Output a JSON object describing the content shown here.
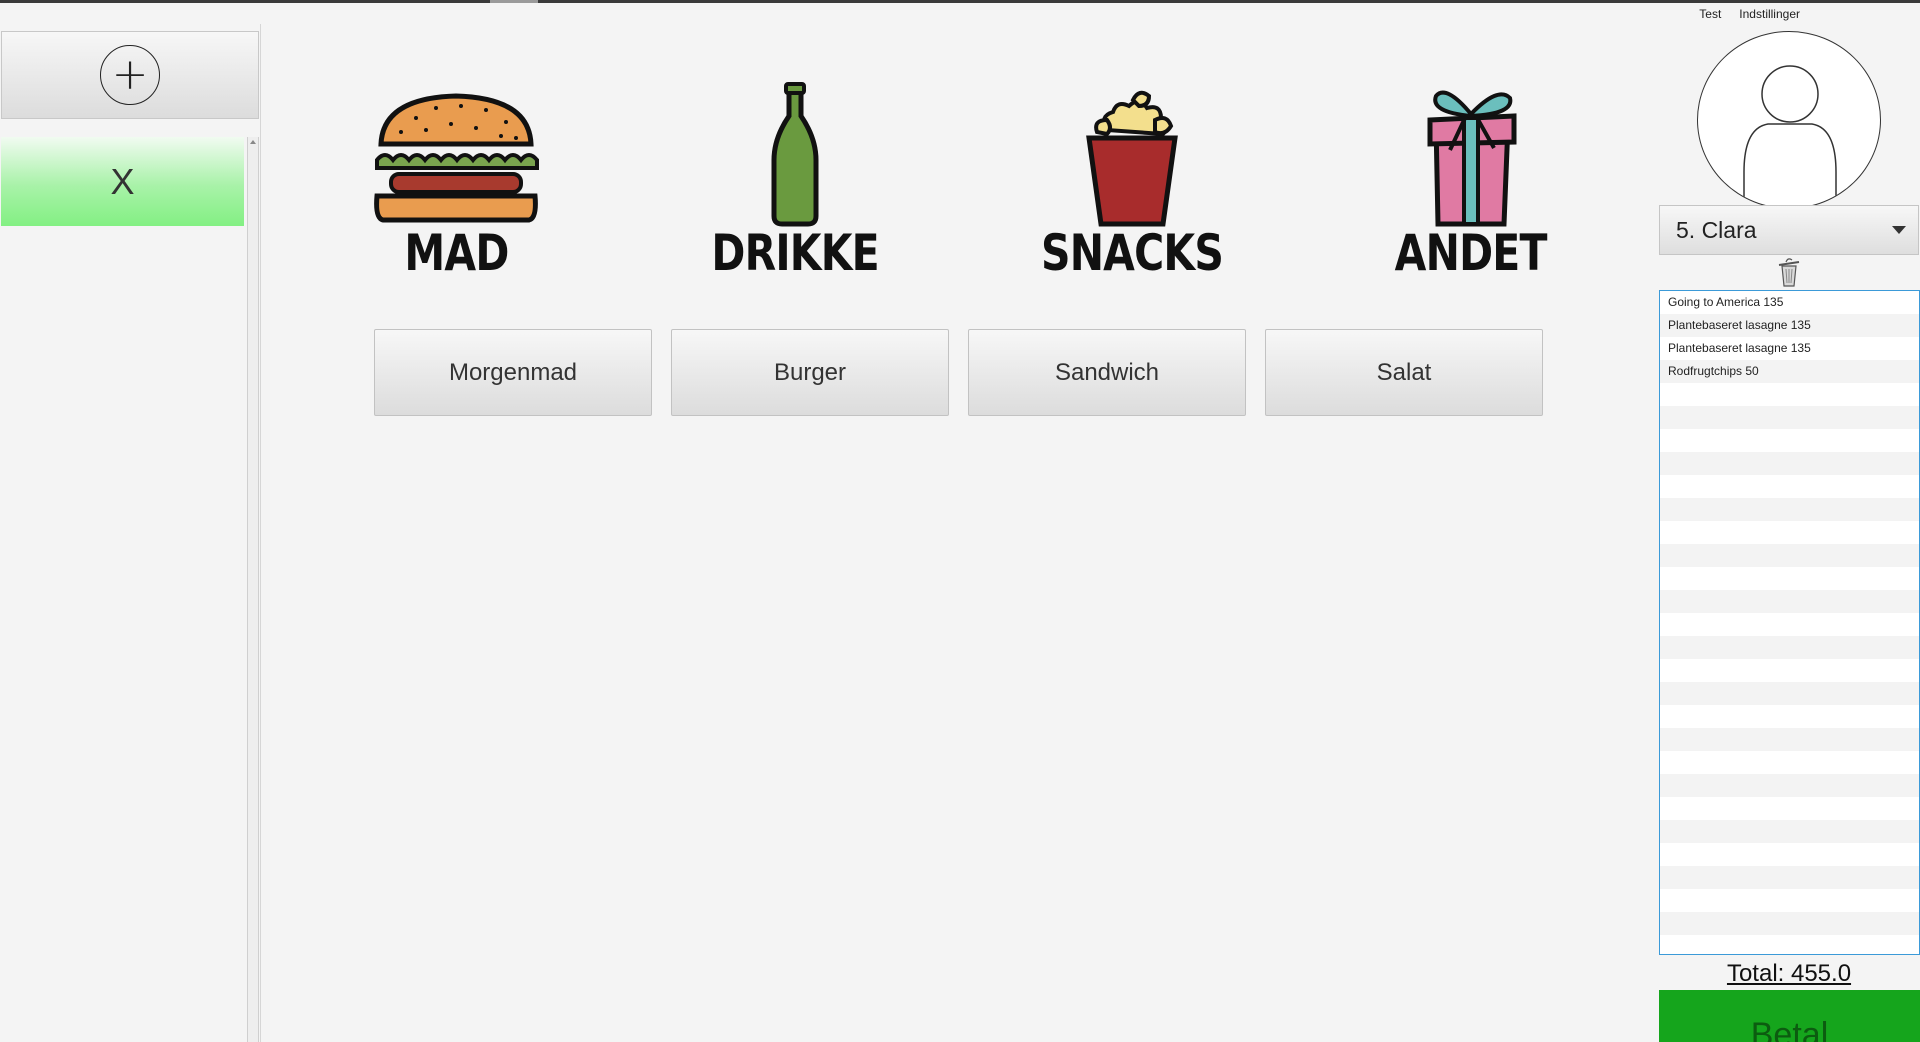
{
  "menubar": {
    "items": [
      "Test",
      "Indstillinger"
    ]
  },
  "left_panel": {
    "add_icon": "plus-circle-icon",
    "tables": [
      {
        "label": "X",
        "color": "#83f083"
      }
    ]
  },
  "categories": [
    {
      "label": "MAD",
      "icon": "burger-icon"
    },
    {
      "label": "DRIKKE",
      "icon": "bottle-icon"
    },
    {
      "label": "SNACKS",
      "icon": "popcorn-icon"
    },
    {
      "label": "ANDET",
      "icon": "gift-icon"
    }
  ],
  "subcategories": [
    "Morgenmad",
    "Burger",
    "Sandwich",
    "Salat"
  ],
  "right_panel": {
    "avatar_icon": "user-avatar-icon",
    "customer": "5. Clara",
    "trash_icon": "trash-icon",
    "order_items": [
      "Going to America 135",
      "Plantebaseret lasagne 135",
      "Plantebaseret lasagne 135",
      "Rodfrugtchips 50"
    ],
    "total": "Total: 455.0",
    "pay_label": "Betal",
    "pay_color": "#15a51c"
  }
}
